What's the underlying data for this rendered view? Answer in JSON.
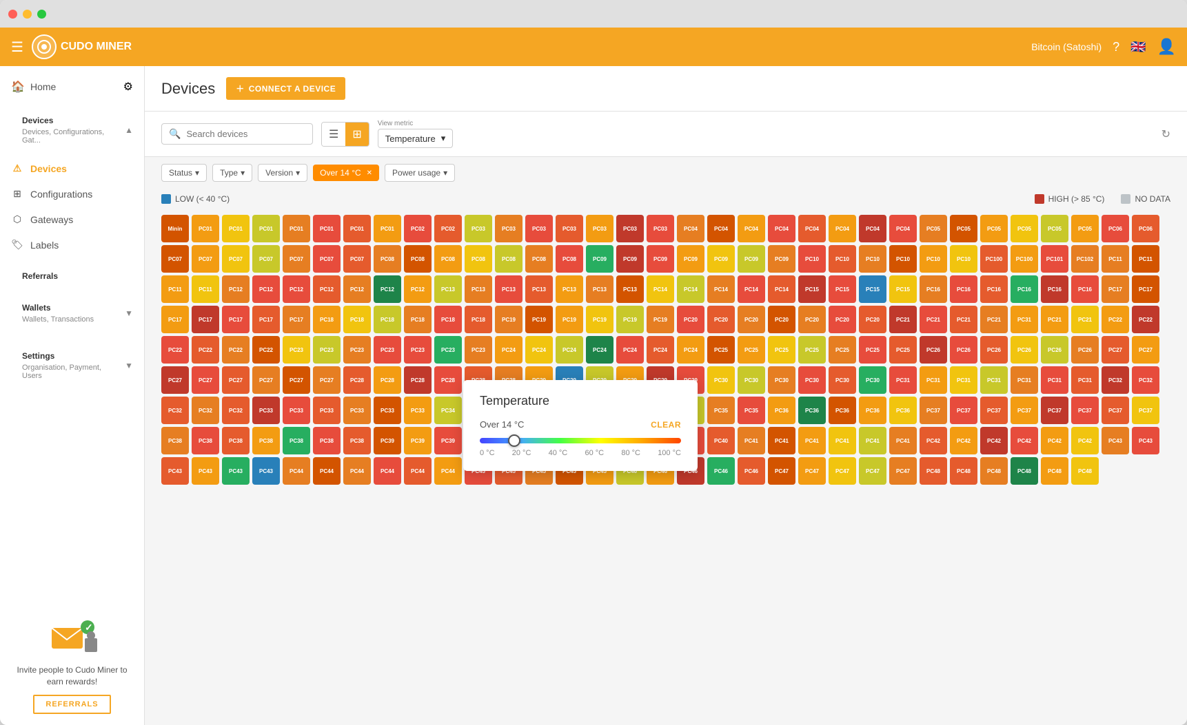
{
  "window": {
    "title": "Cudo Miner"
  },
  "topnav": {
    "logo_text": "CUDO MINER",
    "currency": "Bitcoin (Satoshi)"
  },
  "sidebar": {
    "home_label": "Home",
    "devices_group": {
      "label": "Devices",
      "sub": "Devices, Configurations, Gat...",
      "items": [
        {
          "id": "devices",
          "label": "Devices",
          "active": true
        },
        {
          "id": "configurations",
          "label": "Configurations"
        },
        {
          "id": "gateways",
          "label": "Gateways"
        },
        {
          "id": "labels",
          "label": "Labels"
        }
      ]
    },
    "referrals_label": "Referrals",
    "wallets_group": {
      "label": "Wallets",
      "sub": "Wallets, Transactions"
    },
    "settings_group": {
      "label": "Settings",
      "sub": "Organisation, Payment, Users"
    },
    "referrals_text": "Invite people to Cudo Miner to earn rewards!",
    "referrals_btn": "REFERRALS"
  },
  "header": {
    "title": "Devices",
    "connect_btn": "CONNECT A DEVICE"
  },
  "toolbar": {
    "search_placeholder": "Search devices",
    "view_metric_label": "View metric",
    "view_metric_value": "Temperature"
  },
  "filters": {
    "status_label": "Status",
    "type_label": "Type",
    "version_label": "Version",
    "active_filter": "Over 14 °C",
    "power_label": "Power usage"
  },
  "legend": {
    "low_label": "LOW (< 40 °C)",
    "high_label": "HIGH (> 85 °C)",
    "no_data_label": "NO DATA",
    "low_color": "#2980b9",
    "high_color": "#c0392b",
    "no_data_color": "#bdc3c7"
  },
  "popup": {
    "title": "Temperature",
    "filter_label": "Over 14 °C",
    "clear_label": "CLEAR",
    "slider_min": "0 °C",
    "slider_labels": [
      "0 °C",
      "20 °C",
      "40 °C",
      "60 °C",
      "80 °C",
      "100 °C"
    ]
  },
  "devices": {
    "rows": [
      [
        "Minin",
        "PC01",
        "PC01",
        "PC01",
        "PC01",
        "PC01",
        "PC01",
        "PC01",
        "PC02",
        "PC02",
        "PC03",
        "PC03",
        "PC03",
        "PC03",
        "PC03",
        "PC03",
        "PC03",
        "PC04",
        "PC04",
        "PC04",
        "PC04",
        "PC04",
        "PC04"
      ],
      [
        "PC04",
        "PC04",
        "PC05",
        "PC05",
        "PC05",
        "PC05",
        "PC05",
        "PC05",
        "PC06",
        "PC06",
        "PC07",
        "PC07",
        "PC07",
        "PC07",
        "PC07",
        "PC07",
        "PC07",
        "PC08",
        "PC08",
        "PC08",
        "PC08",
        "PC08",
        "PC08"
      ],
      [
        "PC08",
        "PC09",
        "PC09",
        "PC09",
        "PC09",
        "PC09",
        "PC09",
        "PC09",
        "PC10",
        "PC10",
        "PC10",
        "PC10",
        "PC10",
        "PC10",
        "PC100",
        "PC100",
        "PC101",
        "PC102",
        "PC11",
        "PC11",
        "PC11",
        "PC11",
        "PC12"
      ],
      [
        "PC12",
        "PC12",
        "PC12",
        "PC12",
        "PC12",
        "PC12",
        "PC13",
        "PC13",
        "PC13",
        "PC13",
        "PC13",
        "PC13",
        "PC13",
        "PC14",
        "PC14",
        "PC14",
        "PC14",
        "PC14",
        "PC15",
        "PC15",
        "PC15",
        "PC15",
        "PC16"
      ],
      [
        "PC16",
        "PC16",
        "PC16",
        "PC16",
        "PC16",
        "PC17",
        "PC17",
        "PC17",
        "PC17",
        "PC17",
        "PC17",
        "PC17",
        "PC18",
        "PC18",
        "PC18",
        "PC18",
        "PC18",
        "PC18",
        "PC19",
        "PC19",
        "PC19",
        "PC19",
        "PC19"
      ],
      [
        "PC19",
        "PC20",
        "PC20",
        "PC20",
        "PC20",
        "PC20",
        "PC20",
        "PC20",
        "PC21",
        "PC21",
        "PC21",
        "PC21",
        "PC31",
        "PC21",
        "PC21",
        "PC22",
        "PC22",
        "PC22",
        "PC22",
        "PC22",
        "PC22",
        "PC23",
        "PC23"
      ],
      [
        "PC23",
        "PC23",
        "PC23",
        "PC23",
        "PC23",
        "PC24",
        "PC24",
        "PC24",
        "PC24",
        "PC24",
        "PC24",
        "PC24",
        "PC25",
        "PC25",
        "PC25",
        "PC25",
        "PC25",
        "PC25",
        "PC25",
        "PC26",
        "PC26",
        "PC26",
        "PC26"
      ],
      [
        "PC26",
        "PC26",
        "PC27",
        "PC27",
        "PC27",
        "PC27",
        "PC27",
        "PC27",
        "PC27",
        "PC27",
        "PC28",
        "PC28",
        "PC28",
        "PC28",
        "PC28",
        "PC28",
        "PC29",
        "PC29",
        "PC29",
        "PC29",
        "PC29",
        "PC29",
        "PC30"
      ],
      [
        "PC30",
        "PC30",
        "PC30",
        "PC30",
        "PC30",
        "PC31",
        "PC31",
        "PC31",
        "PC31",
        "PC31",
        "PC31",
        "PC31",
        "PC32",
        "PC32",
        "PC32",
        "PC32",
        "PC32",
        "PC33",
        "PC33",
        "PC33",
        "PC33",
        "PC33",
        "PC33"
      ],
      [
        "PC34",
        "PC34",
        "PC34",
        "PC34",
        "PC34",
        "PC35",
        "PC35",
        "PC35",
        "PC35",
        "PC35",
        "PC35",
        "PC36",
        "PC36",
        "PC36",
        "PC36",
        "PC36",
        "PC37",
        "PC37",
        "PC37",
        "PC37",
        "PC37"
      ],
      [
        "PC37",
        "PC37",
        "PC37",
        "PC38",
        "PC38",
        "PC38",
        "PC38",
        "PC38",
        "PC38",
        "PC38",
        "PC39",
        "PC39",
        "PC39",
        "PC39",
        "PC39",
        "PC39",
        "PC39",
        "PC40",
        "PC40",
        "PC40",
        "PC40",
        "PC40",
        "PC41"
      ],
      [
        "PC41",
        "PC41",
        "PC41",
        "PC41",
        "PC41",
        "PC42",
        "PC42",
        "PC42",
        "PC42",
        "PC42",
        "PC42",
        "PC43",
        "PC43",
        "PC43",
        "PC43",
        "PC43",
        "PC43",
        "PC44",
        "PC44",
        "PC44",
        "PC44",
        "PC44",
        "PC44"
      ],
      [
        "PC45",
        "PC45",
        "PC45",
        "PC45",
        "PC45",
        "PC46",
        "PC46",
        "PC46",
        "PC46",
        "PC46",
        "PC47",
        "PC47",
        "PC47",
        "PC47",
        "PC47",
        "PC48",
        "PC48",
        "PC48",
        "PC48",
        "PC48",
        "PC48"
      ]
    ]
  }
}
